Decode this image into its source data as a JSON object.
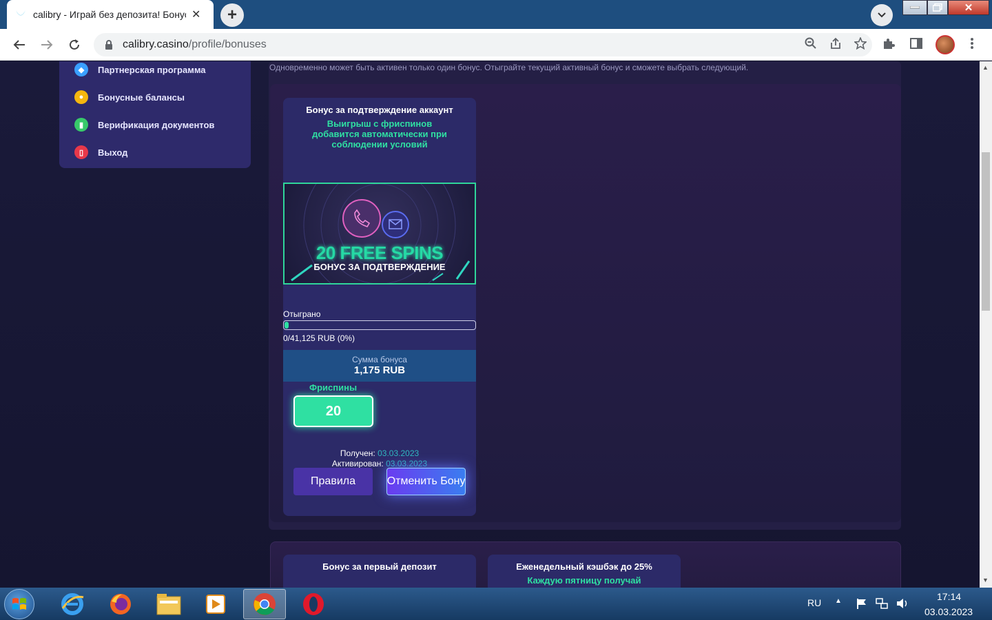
{
  "browser": {
    "tab_title": "calibry - Играй без депозита! Бонусы",
    "url_host": "calibry.casino",
    "url_path": "/profile/bonuses"
  },
  "sidebar": {
    "items": [
      {
        "label": "Партнерская программа",
        "icon": "diamond-icon",
        "color": "#3aa0ff"
      },
      {
        "label": "Бонусные балансы",
        "icon": "coin-icon",
        "color": "#f5b60f"
      },
      {
        "label": "Верификация документов",
        "icon": "document-icon",
        "color": "#38c96a"
      },
      {
        "label": "Выход",
        "icon": "exit-icon",
        "color": "#e8384a"
      }
    ]
  },
  "notice": "Одновременно может быть активен только один бонус. Отыграйте текущий активный бонус и сможете выбрать следующий.",
  "active_bonus": {
    "title": "Бонус за подтверждение аккаунт",
    "subtitle": "Выигрыш с фриспинов добавится автоматически при соблюдении условий",
    "banner_title": "20 FREE SPINS",
    "banner_subtitle": "БОНУС ЗА ПОДТВЕРЖДЕНИЕ",
    "played_label": "Отыграно",
    "progress_fraction": 0.02,
    "progress_text": "0/41,125 RUB (0%)",
    "sum_label": "Сумма бонуса",
    "sum_value": "1,175 RUB",
    "freespins_label": "Фриспины",
    "freespins_value": "20",
    "received_label": "Получен:",
    "received_date": "03.03.2023",
    "activated_label": "Активирован:",
    "activated_date": "03.03.2023",
    "rules_button": "Правила",
    "cancel_button": "Отменить Бонус"
  },
  "other_bonuses": [
    {
      "title": "Бонус за первый депозит",
      "subtitle": ""
    },
    {
      "title": "Еженедельный кэшбэк до 25%",
      "subtitle": "Каждую пятницу получай"
    }
  ],
  "taskbar": {
    "lang": "RU",
    "time": "17:14",
    "date": "03.03.2023"
  },
  "colors": {
    "accent_green": "#2fe0a2",
    "card_bg": "#2c2a68",
    "sum_bg": "#1f4f86"
  }
}
